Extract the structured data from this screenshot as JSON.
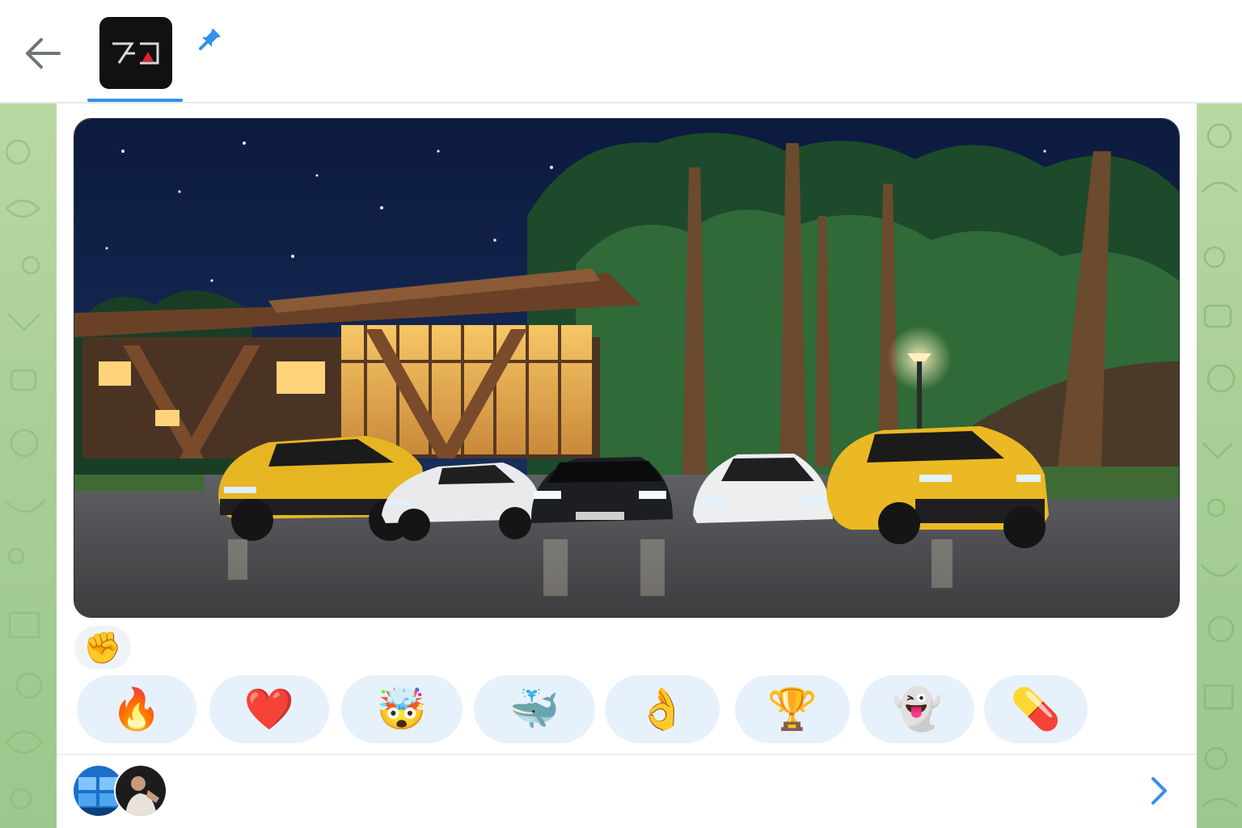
{
  "header": {
    "back_icon": "arrow-left-icon",
    "channel_logo_icon": "channel-logo-icon",
    "pin_icon": "pin-icon",
    "accent": "#3390ec"
  },
  "message": {
    "photo_icon": "night-supercars-photo",
    "my_reaction": "✊",
    "reactions": [
      {
        "emoji": "🔥",
        "name": "fire"
      },
      {
        "emoji": "❤️",
        "name": "heart"
      },
      {
        "emoji": "🤯",
        "name": "exploding-head"
      },
      {
        "emoji": "🐳",
        "name": "whale"
      },
      {
        "emoji": "👌",
        "name": "ok-hand"
      },
      {
        "emoji": "🏆",
        "name": "trophy"
      },
      {
        "emoji": "👻",
        "name": "ghost"
      },
      {
        "emoji": "💊",
        "name": "pill"
      }
    ]
  },
  "footer": {
    "viewer_icons": [
      "viewer-avatar-1",
      "viewer-avatar-2"
    ],
    "next_icon": "chevron-right-icon"
  },
  "colors": {
    "reaction_bg": "#e7f1fb",
    "wallpaper": "#a9cf96"
  }
}
